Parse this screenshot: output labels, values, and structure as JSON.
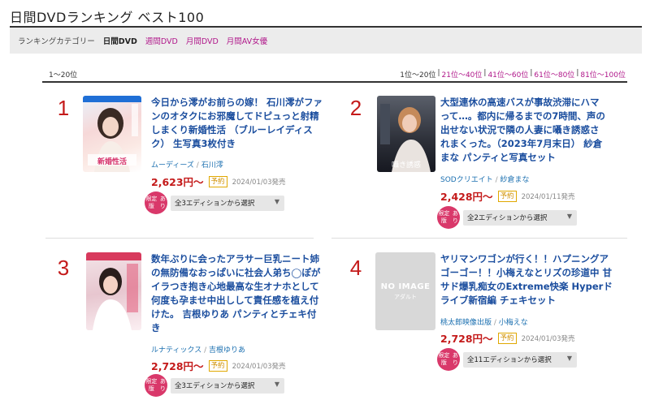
{
  "page": {
    "title": "日間DVDランキング ベスト100"
  },
  "categories": {
    "label": "ランキングカテゴリー",
    "current": "日間DVD",
    "links": [
      "週間DVD",
      "月間DVD",
      "月間AV女優"
    ]
  },
  "ranges": {
    "current_label": "1〜20位",
    "current": "1位〜20位",
    "links": [
      "21位〜40位",
      "41位〜60位",
      "61位〜80位",
      "81位〜100位"
    ]
  },
  "items": [
    {
      "rank": "1",
      "title": "今日から澪がお前らの嫁！ 石川澪がファンのオタクにお邪魔してドピュっと射精しまくり新婚性活 （ブルーレイディスク） 生写真3枚付き",
      "maker": "ムーディーズ",
      "performer": "石川澪",
      "price": "2,623円〜",
      "reserve": "予約",
      "date": "2024/01/03発売",
      "limited": "限定版あり",
      "editions": "全3エディションから選択",
      "thumb_caption": "新婚性活"
    },
    {
      "rank": "2",
      "title": "大型連休の高速バスが事故渋滞にハマって…。都内に帰るまでの7時間、声の出せない状況で隣の人妻に囁き誘惑されまくった。（2023年7月末日） 紗倉まな パンティと写真セット",
      "maker": "SODクリエイト",
      "performer": "紗倉まな",
      "price": "2,428円〜",
      "reserve": "予約",
      "date": "2024/01/11発売",
      "limited": "限定版あり",
      "editions": "全2エディションから選択",
      "thumb_caption": "囁き誘惑"
    },
    {
      "rank": "3",
      "title": "数年ぶりに会ったアラサー巨乳ニート姉の無防備なおっぱいに社会人弟ち◯ぽがイラつき抱き心地最高な生オナホとして何度も孕ませ中出しして責任感を植え付けた。 吉根ゆりあ パンティとチェキ付き",
      "maker": "ルナティックス",
      "performer": "吉根ゆりあ",
      "price": "2,728円〜",
      "reserve": "予約",
      "date": "2024/01/03発売",
      "limited": "限定版あり",
      "editions": "全3エディションから選択",
      "thumb_caption": ""
    },
    {
      "rank": "4",
      "title": "ヤリマンワゴンが行く！！ハプニングア ゴーゴー！！小梅えなとリズの珍道中 甘サド爆乳痴女のExtreme快楽 Hyperドライブ新宿編 チェキセット",
      "maker": "桃太郎映像出版",
      "performer": "小梅えな",
      "price": "2,728円〜",
      "reserve": "予約",
      "date": "2024/01/03発売",
      "limited": "限定版あり",
      "editions": "全11エディションから選択",
      "noimage": "NO IMAGE",
      "noimage_sub": "アダルト"
    }
  ],
  "colors": {
    "accent": "#c41a1a",
    "link": "#1a4d9e",
    "category_link": "#b0178a",
    "limited_badge": "#d9386a"
  }
}
